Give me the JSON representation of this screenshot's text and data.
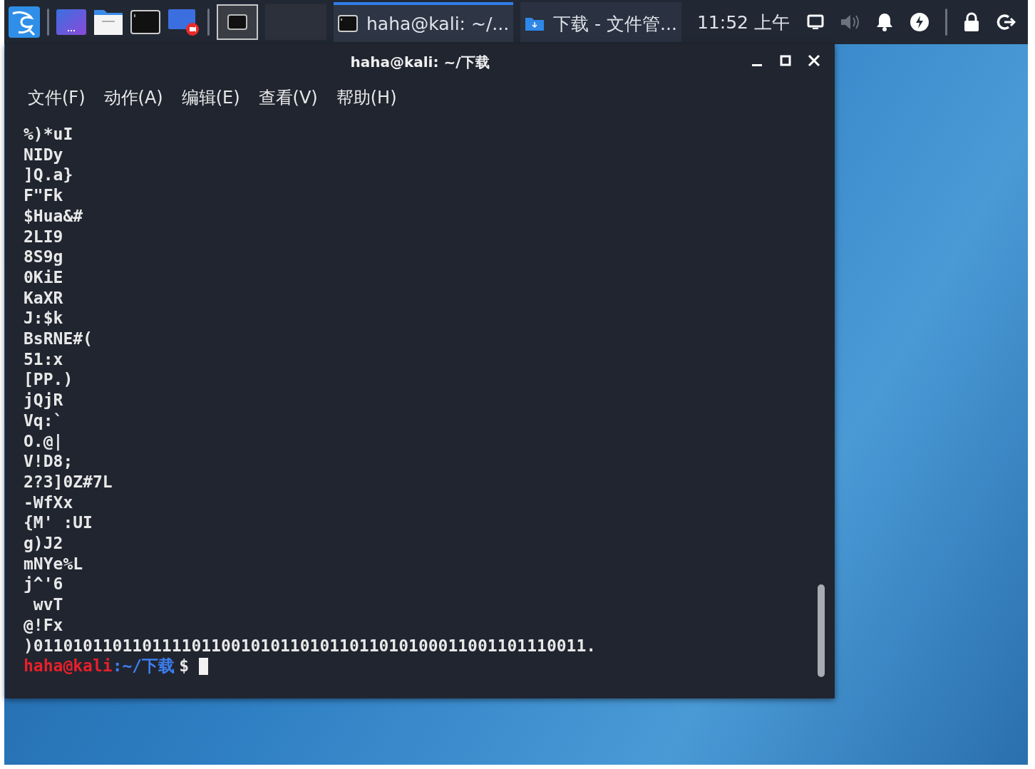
{
  "taskbar": {
    "workspaces": [
      {
        "selected": true
      },
      {
        "selected": false
      }
    ],
    "tasks": [
      {
        "kind": "terminal",
        "label": "haha@kali: ~/...",
        "selected": true
      },
      {
        "kind": "folder",
        "label": "下载 - 文件管...",
        "selected": false
      }
    ],
    "clock": "11:52 上午"
  },
  "window": {
    "title": "haha@kali: ~/下载",
    "menu": [
      "文件(F)",
      "动作(A)",
      "编辑(E)",
      "查看(V)",
      "帮助(H)"
    ],
    "lines": [
      "%)*uI",
      "NIDy",
      "]Q.a}",
      "F\"Fk",
      "$Hua&#",
      "2LI9",
      "8S9g",
      "0KiE",
      "KaXR",
      "J:$k",
      "BsRNE#(",
      "51:x",
      "[PP.)",
      "jQjR",
      "Vq:`",
      "O.@|",
      "V!D8;",
      "2?3]0Z#7L",
      "-WfXx",
      "{M' :UI",
      "g)J2",
      "mNYe%L",
      "j^'6",
      " wvT",
      "@!Fx",
      ")01101011011011110110010101101011011010100011001101110011."
    ],
    "prompt": {
      "user_host": "haha@kali",
      "path": ":~/下载",
      "symbol": "$"
    }
  }
}
